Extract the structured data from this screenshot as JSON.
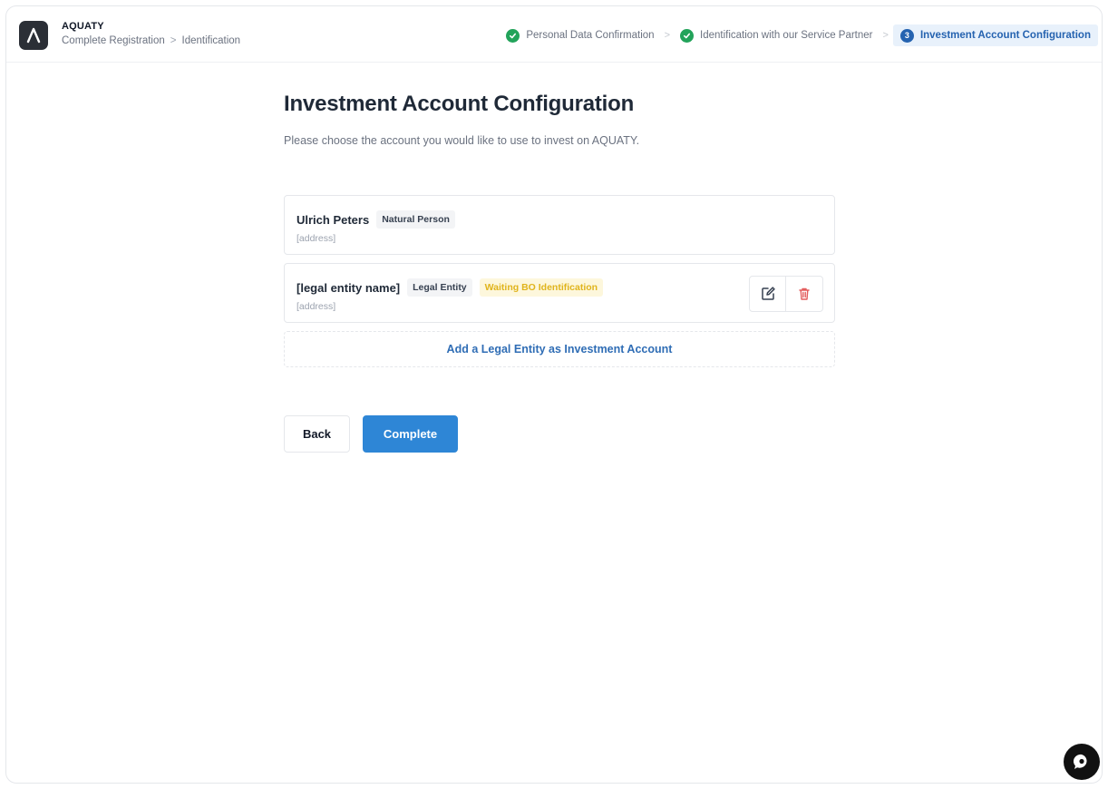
{
  "app": {
    "brand": "AQUATY",
    "breadcrumb": [
      "Complete Registration",
      "Identification"
    ],
    "breadcrumb_separator": ">"
  },
  "steps": [
    {
      "label": "Personal Data Confirmation",
      "status": "done"
    },
    {
      "label": "Identification with our Service Partner",
      "status": "done"
    },
    {
      "label": "Investment Account Configuration",
      "status": "active",
      "number": "3"
    }
  ],
  "main": {
    "title": "Investment Account Configuration",
    "subtitle": "Please choose the account you would like to use to invest on AQUATY."
  },
  "accounts": [
    {
      "name": "Ulrich Peters",
      "type": "Natural Person",
      "address": "[address]"
    },
    {
      "name": "[legal entity name]",
      "type": "Legal Entity",
      "status": "Waiting BO Identification",
      "address": "[address]"
    }
  ],
  "add_entity_label": "Add a Legal Entity as Investment Account",
  "buttons": {
    "back": "Back",
    "complete": "Complete"
  },
  "colors": {
    "accent": "#2e86d6",
    "success": "#22a35a",
    "warning": "#e0b41c",
    "danger": "#e35d5d"
  }
}
